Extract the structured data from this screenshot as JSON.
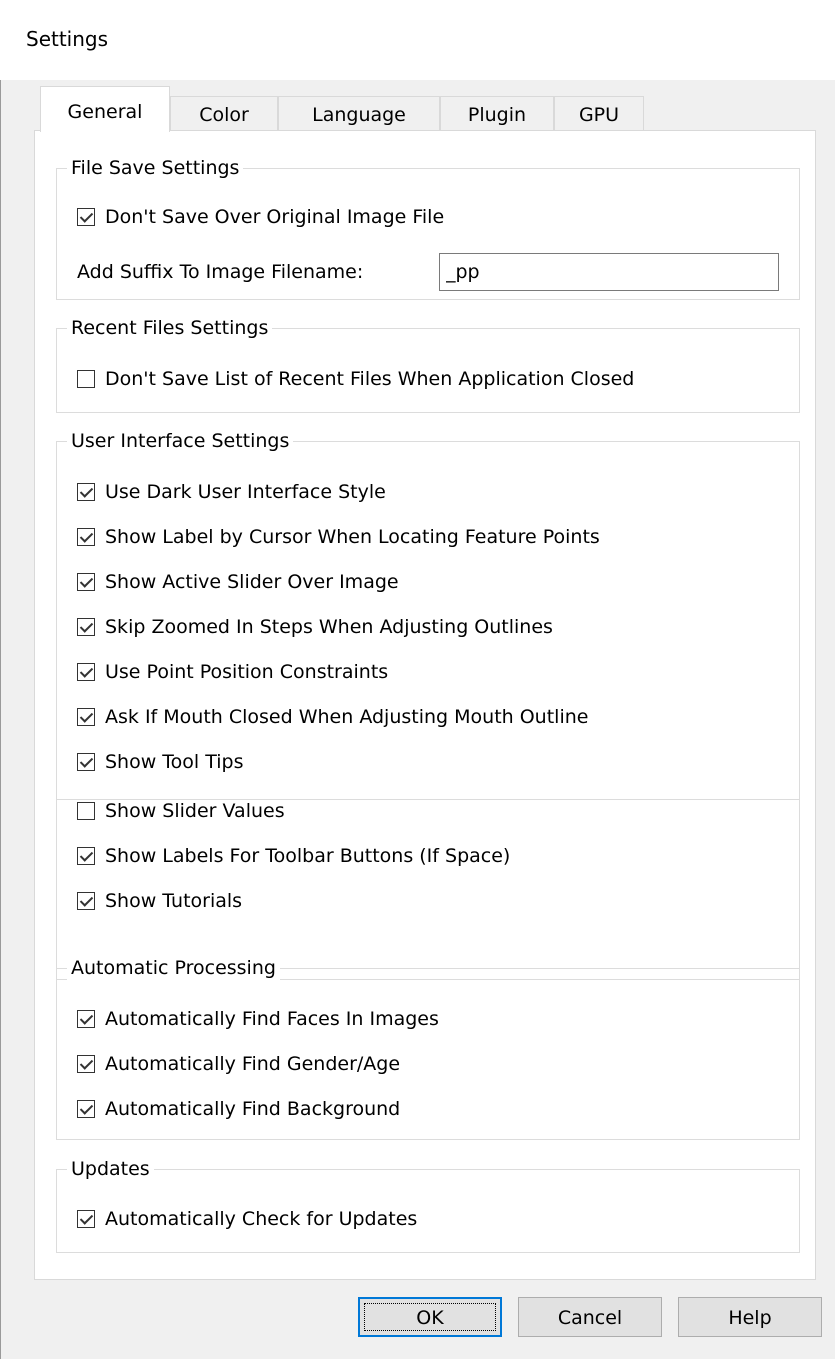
{
  "window": {
    "title": "Settings"
  },
  "tabs": [
    {
      "label": "General",
      "active": true
    },
    {
      "label": "Color",
      "active": false
    },
    {
      "label": "Language",
      "active": false
    },
    {
      "label": "Plugin",
      "active": false
    },
    {
      "label": "GPU",
      "active": false
    }
  ],
  "file_save": {
    "title": "File Save Settings",
    "dont_save_over": {
      "label": "Don't Save Over Original Image File",
      "checked": true
    },
    "suffix_label": "Add Suffix To Image Filename:",
    "suffix_value": "_pp"
  },
  "recent_files": {
    "title": "Recent Files Settings",
    "dont_save_list": {
      "label": "Don't Save List of Recent Files When Application Closed",
      "checked": false
    }
  },
  "ui_settings": {
    "title": "User Interface Settings",
    "items": [
      {
        "label": "Use Dark User Interface Style",
        "checked": true
      },
      {
        "label": "Show Label by Cursor When Locating Feature Points",
        "checked": true
      },
      {
        "label": "Show Active Slider Over Image",
        "checked": true
      },
      {
        "label": "Skip Zoomed In Steps When Adjusting Outlines",
        "checked": true
      },
      {
        "label": "Use Point Position Constraints",
        "checked": true
      },
      {
        "label": "Ask If Mouth Closed When Adjusting Mouth Outline",
        "checked": true
      },
      {
        "label": "Show Tool Tips",
        "checked": true
      },
      {
        "label": "Show Slider Values",
        "checked": false
      },
      {
        "label": "Show Labels For Toolbar Buttons (If Space)",
        "checked": true
      },
      {
        "label": "Show Tutorials",
        "checked": true
      }
    ]
  },
  "auto_processing": {
    "title": "Automatic Processing",
    "items": [
      {
        "label": "Automatically Find Faces In Images",
        "checked": true
      },
      {
        "label": "Automatically Find Gender/Age",
        "checked": true
      },
      {
        "label": "Automatically Find Background",
        "checked": true
      }
    ]
  },
  "updates": {
    "title": "Updates",
    "items": [
      {
        "label": "Automatically Check for Updates",
        "checked": true
      }
    ]
  },
  "buttons": {
    "ok": "OK",
    "cancel": "Cancel",
    "help": "Help"
  }
}
